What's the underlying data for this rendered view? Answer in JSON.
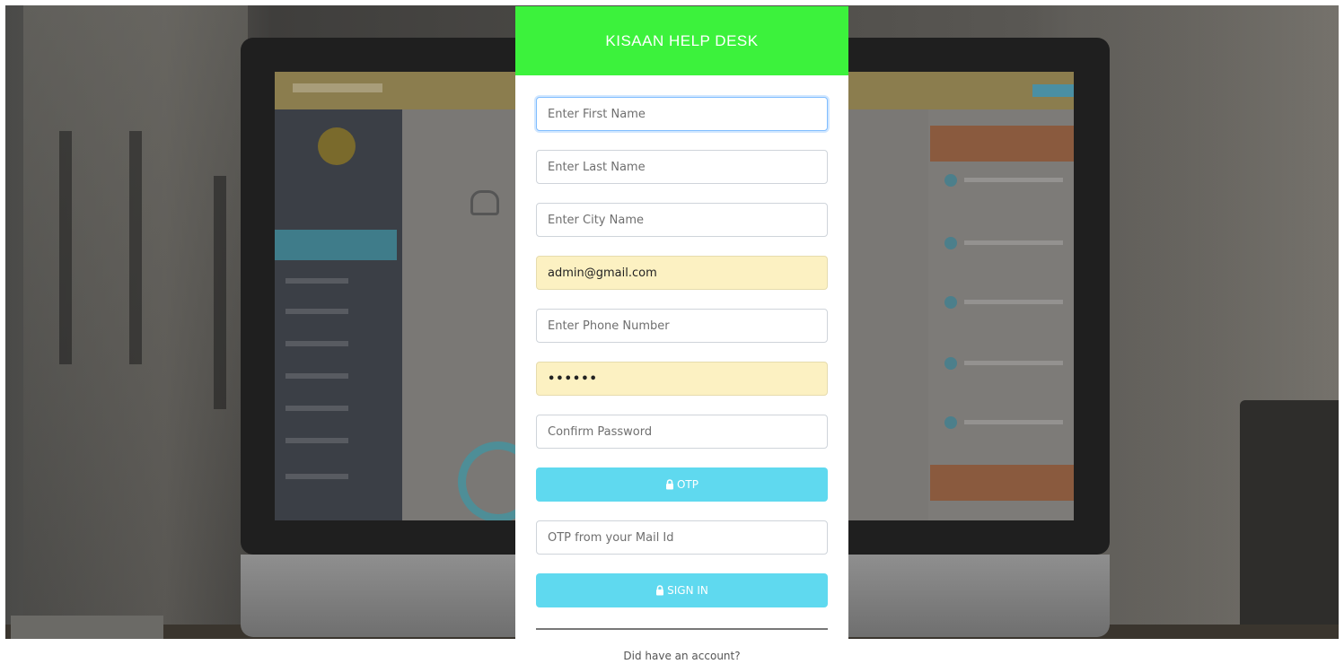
{
  "card": {
    "title": "KISAAN HELP DESK",
    "header_color": "#3cf23c"
  },
  "form": {
    "first_name": {
      "placeholder": "Enter First Name",
      "value": ""
    },
    "last_name": {
      "placeholder": "Enter Last Name",
      "value": ""
    },
    "city": {
      "placeholder": "Enter City Name",
      "value": ""
    },
    "email": {
      "placeholder": "",
      "value": "admin@gmail.com"
    },
    "phone": {
      "placeholder": "Enter Phone Number",
      "value": ""
    },
    "password": {
      "placeholder": "",
      "value": "••••••"
    },
    "confirm_password": {
      "placeholder": "Confirm Password",
      "value": ""
    },
    "otp_button_label": "OTP",
    "otp_input": {
      "placeholder": "OTP from your Mail Id",
      "value": ""
    },
    "signin_button_label": "SIGN IN",
    "button_color": "#5fd9ef",
    "autofill_color": "#fcf1c2"
  },
  "footer": {
    "account_text": "Did have an account?"
  },
  "icons": {
    "button_icon": "lock-icon"
  }
}
